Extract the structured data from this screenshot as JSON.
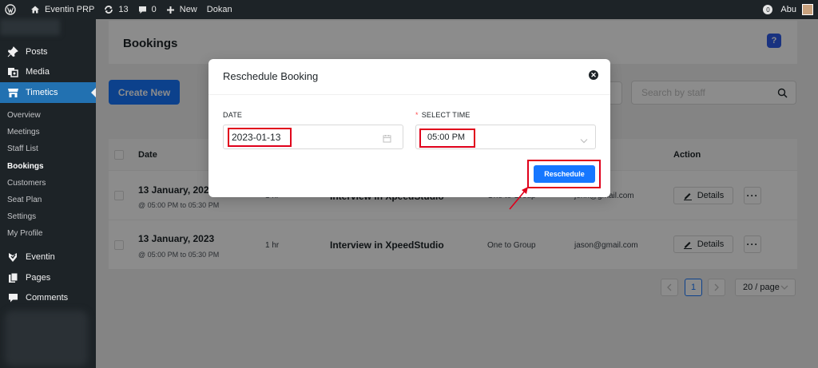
{
  "adminbar": {
    "site_name": "Eventin PRP",
    "updates_count": "13",
    "comments_count": "0",
    "new_label": "New",
    "dokan_label": "Dokan",
    "notification_count": "0",
    "user_name": "Abu"
  },
  "sidebar": {
    "menu": {
      "posts": "Posts",
      "media": "Media",
      "timetics": "Timetics",
      "eventin": "Eventin",
      "pages": "Pages",
      "comments": "Comments"
    },
    "submenu": [
      "Overview",
      "Meetings",
      "Staff List",
      "Bookings",
      "Customers",
      "Seat Plan",
      "Settings",
      "My Profile"
    ],
    "current_submenu": "Bookings"
  },
  "page": {
    "title": "Bookings",
    "help_icon": "?",
    "create_button": "Create New",
    "search_placeholder": "Search by staff"
  },
  "table": {
    "headers": {
      "date": "Date",
      "action": "Action"
    },
    "rows": [
      {
        "date": "13 January, 2023",
        "time": "@ 05:00 PM to 05:30 PM",
        "duration": "1 hr",
        "meeting": "Interview in XpeedStudio",
        "type": "One to Group",
        "email": "john@gmail.com",
        "details": "Details"
      },
      {
        "date": "13 January, 2023",
        "time": "@ 05:00 PM to 05:30 PM",
        "duration": "1 hr",
        "meeting": "Interview in XpeedStudio",
        "type": "One to Group",
        "email": "jason@gmail.com",
        "details": "Details"
      }
    ]
  },
  "pagination": {
    "current_page": "1",
    "page_size": "20 / page"
  },
  "modal": {
    "title": "Reschedule Booking",
    "date_label": "DATE",
    "date_value": "2023-01-13",
    "time_label": "SELECT TIME",
    "required_mark": "*",
    "time_value": "05:00 PM",
    "reschedule_button": "Reschedule",
    "close_icon": "close-icon"
  },
  "colors": {
    "primary": "#1677ff",
    "admin_dark": "#1d2327",
    "wp_blue": "#2271b1",
    "highlight": "#e0001b"
  }
}
